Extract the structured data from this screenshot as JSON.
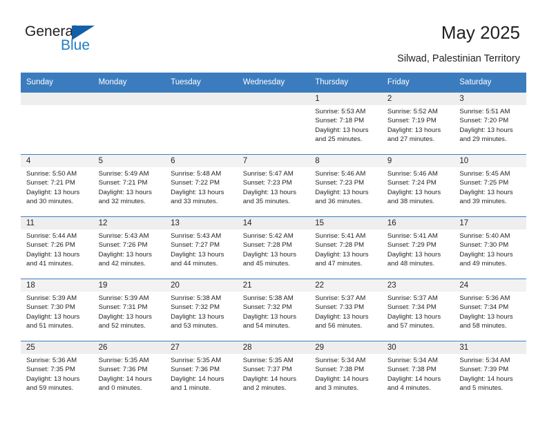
{
  "brand": {
    "name_part1": "General",
    "name_part2": "Blue"
  },
  "header": {
    "month_title": "May 2025",
    "location": "Silwad, Palestinian Territory"
  },
  "calendar": {
    "weekday_headers": [
      "Sunday",
      "Monday",
      "Tuesday",
      "Wednesday",
      "Thursday",
      "Friday",
      "Saturday"
    ],
    "header_bg": "#3b7cbf",
    "header_text": "#ffffff",
    "shaded_row_bg": "#eeeeee",
    "weeks": [
      [
        {
          "day": "",
          "sunrise": "",
          "sunset": "",
          "daylight_line1": "",
          "daylight_line2": ""
        },
        {
          "day": "",
          "sunrise": "",
          "sunset": "",
          "daylight_line1": "",
          "daylight_line2": ""
        },
        {
          "day": "",
          "sunrise": "",
          "sunset": "",
          "daylight_line1": "",
          "daylight_line2": ""
        },
        {
          "day": "",
          "sunrise": "",
          "sunset": "",
          "daylight_line1": "",
          "daylight_line2": ""
        },
        {
          "day": "1",
          "sunrise": "Sunrise: 5:53 AM",
          "sunset": "Sunset: 7:18 PM",
          "daylight_line1": "Daylight: 13 hours",
          "daylight_line2": "and 25 minutes."
        },
        {
          "day": "2",
          "sunrise": "Sunrise: 5:52 AM",
          "sunset": "Sunset: 7:19 PM",
          "daylight_line1": "Daylight: 13 hours",
          "daylight_line2": "and 27 minutes."
        },
        {
          "day": "3",
          "sunrise": "Sunrise: 5:51 AM",
          "sunset": "Sunset: 7:20 PM",
          "daylight_line1": "Daylight: 13 hours",
          "daylight_line2": "and 29 minutes."
        }
      ],
      [
        {
          "day": "4",
          "sunrise": "Sunrise: 5:50 AM",
          "sunset": "Sunset: 7:21 PM",
          "daylight_line1": "Daylight: 13 hours",
          "daylight_line2": "and 30 minutes."
        },
        {
          "day": "5",
          "sunrise": "Sunrise: 5:49 AM",
          "sunset": "Sunset: 7:21 PM",
          "daylight_line1": "Daylight: 13 hours",
          "daylight_line2": "and 32 minutes."
        },
        {
          "day": "6",
          "sunrise": "Sunrise: 5:48 AM",
          "sunset": "Sunset: 7:22 PM",
          "daylight_line1": "Daylight: 13 hours",
          "daylight_line2": "and 33 minutes."
        },
        {
          "day": "7",
          "sunrise": "Sunrise: 5:47 AM",
          "sunset": "Sunset: 7:23 PM",
          "daylight_line1": "Daylight: 13 hours",
          "daylight_line2": "and 35 minutes."
        },
        {
          "day": "8",
          "sunrise": "Sunrise: 5:46 AM",
          "sunset": "Sunset: 7:23 PM",
          "daylight_line1": "Daylight: 13 hours",
          "daylight_line2": "and 36 minutes."
        },
        {
          "day": "9",
          "sunrise": "Sunrise: 5:46 AM",
          "sunset": "Sunset: 7:24 PM",
          "daylight_line1": "Daylight: 13 hours",
          "daylight_line2": "and 38 minutes."
        },
        {
          "day": "10",
          "sunrise": "Sunrise: 5:45 AM",
          "sunset": "Sunset: 7:25 PM",
          "daylight_line1": "Daylight: 13 hours",
          "daylight_line2": "and 39 minutes."
        }
      ],
      [
        {
          "day": "11",
          "sunrise": "Sunrise: 5:44 AM",
          "sunset": "Sunset: 7:26 PM",
          "daylight_line1": "Daylight: 13 hours",
          "daylight_line2": "and 41 minutes."
        },
        {
          "day": "12",
          "sunrise": "Sunrise: 5:43 AM",
          "sunset": "Sunset: 7:26 PM",
          "daylight_line1": "Daylight: 13 hours",
          "daylight_line2": "and 42 minutes."
        },
        {
          "day": "13",
          "sunrise": "Sunrise: 5:43 AM",
          "sunset": "Sunset: 7:27 PM",
          "daylight_line1": "Daylight: 13 hours",
          "daylight_line2": "and 44 minutes."
        },
        {
          "day": "14",
          "sunrise": "Sunrise: 5:42 AM",
          "sunset": "Sunset: 7:28 PM",
          "daylight_line1": "Daylight: 13 hours",
          "daylight_line2": "and 45 minutes."
        },
        {
          "day": "15",
          "sunrise": "Sunrise: 5:41 AM",
          "sunset": "Sunset: 7:28 PM",
          "daylight_line1": "Daylight: 13 hours",
          "daylight_line2": "and 47 minutes."
        },
        {
          "day": "16",
          "sunrise": "Sunrise: 5:41 AM",
          "sunset": "Sunset: 7:29 PM",
          "daylight_line1": "Daylight: 13 hours",
          "daylight_line2": "and 48 minutes."
        },
        {
          "day": "17",
          "sunrise": "Sunrise: 5:40 AM",
          "sunset": "Sunset: 7:30 PM",
          "daylight_line1": "Daylight: 13 hours",
          "daylight_line2": "and 49 minutes."
        }
      ],
      [
        {
          "day": "18",
          "sunrise": "Sunrise: 5:39 AM",
          "sunset": "Sunset: 7:30 PM",
          "daylight_line1": "Daylight: 13 hours",
          "daylight_line2": "and 51 minutes."
        },
        {
          "day": "19",
          "sunrise": "Sunrise: 5:39 AM",
          "sunset": "Sunset: 7:31 PM",
          "daylight_line1": "Daylight: 13 hours",
          "daylight_line2": "and 52 minutes."
        },
        {
          "day": "20",
          "sunrise": "Sunrise: 5:38 AM",
          "sunset": "Sunset: 7:32 PM",
          "daylight_line1": "Daylight: 13 hours",
          "daylight_line2": "and 53 minutes."
        },
        {
          "day": "21",
          "sunrise": "Sunrise: 5:38 AM",
          "sunset": "Sunset: 7:32 PM",
          "daylight_line1": "Daylight: 13 hours",
          "daylight_line2": "and 54 minutes."
        },
        {
          "day": "22",
          "sunrise": "Sunrise: 5:37 AM",
          "sunset": "Sunset: 7:33 PM",
          "daylight_line1": "Daylight: 13 hours",
          "daylight_line2": "and 56 minutes."
        },
        {
          "day": "23",
          "sunrise": "Sunrise: 5:37 AM",
          "sunset": "Sunset: 7:34 PM",
          "daylight_line1": "Daylight: 13 hours",
          "daylight_line2": "and 57 minutes."
        },
        {
          "day": "24",
          "sunrise": "Sunrise: 5:36 AM",
          "sunset": "Sunset: 7:34 PM",
          "daylight_line1": "Daylight: 13 hours",
          "daylight_line2": "and 58 minutes."
        }
      ],
      [
        {
          "day": "25",
          "sunrise": "Sunrise: 5:36 AM",
          "sunset": "Sunset: 7:35 PM",
          "daylight_line1": "Daylight: 13 hours",
          "daylight_line2": "and 59 minutes."
        },
        {
          "day": "26",
          "sunrise": "Sunrise: 5:35 AM",
          "sunset": "Sunset: 7:36 PM",
          "daylight_line1": "Daylight: 14 hours",
          "daylight_line2": "and 0 minutes."
        },
        {
          "day": "27",
          "sunrise": "Sunrise: 5:35 AM",
          "sunset": "Sunset: 7:36 PM",
          "daylight_line1": "Daylight: 14 hours",
          "daylight_line2": "and 1 minute."
        },
        {
          "day": "28",
          "sunrise": "Sunrise: 5:35 AM",
          "sunset": "Sunset: 7:37 PM",
          "daylight_line1": "Daylight: 14 hours",
          "daylight_line2": "and 2 minutes."
        },
        {
          "day": "29",
          "sunrise": "Sunrise: 5:34 AM",
          "sunset": "Sunset: 7:38 PM",
          "daylight_line1": "Daylight: 14 hours",
          "daylight_line2": "and 3 minutes."
        },
        {
          "day": "30",
          "sunrise": "Sunrise: 5:34 AM",
          "sunset": "Sunset: 7:38 PM",
          "daylight_line1": "Daylight: 14 hours",
          "daylight_line2": "and 4 minutes."
        },
        {
          "day": "31",
          "sunrise": "Sunrise: 5:34 AM",
          "sunset": "Sunset: 7:39 PM",
          "daylight_line1": "Daylight: 14 hours",
          "daylight_line2": "and 5 minutes."
        }
      ]
    ]
  }
}
